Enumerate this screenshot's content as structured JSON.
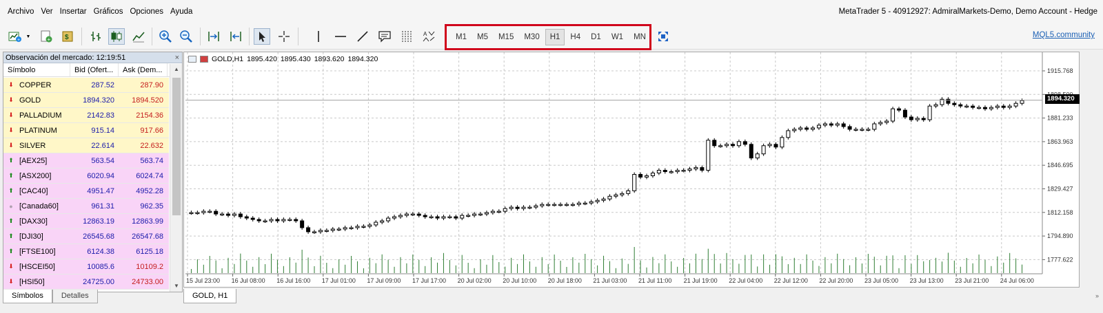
{
  "menu": [
    "Archivo",
    "Ver",
    "Insertar",
    "Gráficos",
    "Opciones",
    "Ayuda"
  ],
  "window_title": "MetaTrader 5 - 40912927: AdmiralMarkets-Demo, Demo Account - Hedge",
  "toolbar": {
    "timeframes": [
      {
        "label": "M1",
        "active": false
      },
      {
        "label": "M5",
        "active": false
      },
      {
        "label": "M15",
        "active": false
      },
      {
        "label": "M30",
        "active": false
      },
      {
        "label": "H1",
        "active": true
      },
      {
        "label": "H4",
        "active": false
      },
      {
        "label": "D1",
        "active": false
      },
      {
        "label": "W1",
        "active": false
      },
      {
        "label": "MN",
        "active": false
      }
    ],
    "timeframe_highlight_color": "#d0021b",
    "mql5_link": "MQL5.community"
  },
  "market_watch": {
    "title": "Observación del mercado: 12:19:51",
    "columns": [
      "Símbolo",
      "Bid (Ofert...",
      "Ask (Dem..."
    ],
    "rows": [
      {
        "symbol": "COPPER",
        "bid": "287.52",
        "ask": "287.90",
        "trend": "down",
        "group": "metal"
      },
      {
        "symbol": "GOLD",
        "bid": "1894.320",
        "ask": "1894.520",
        "trend": "down",
        "group": "metal"
      },
      {
        "symbol": "PALLADIUM",
        "bid": "2142.83",
        "ask": "2154.36",
        "trend": "down",
        "group": "metal"
      },
      {
        "symbol": "PLATINUM",
        "bid": "915.14",
        "ask": "917.66",
        "trend": "down",
        "group": "metal"
      },
      {
        "symbol": "SILVER",
        "bid": "22.614",
        "ask": "22.632",
        "trend": "down",
        "group": "metal"
      },
      {
        "symbol": "[AEX25]",
        "bid": "563.54",
        "ask": "563.74",
        "trend": "up",
        "group": "index"
      },
      {
        "symbol": "[ASX200]",
        "bid": "6020.94",
        "ask": "6024.74",
        "trend": "up",
        "group": "index"
      },
      {
        "symbol": "[CAC40]",
        "bid": "4951.47",
        "ask": "4952.28",
        "trend": "up",
        "group": "index"
      },
      {
        "symbol": "[Canada60]",
        "bid": "961.31",
        "ask": "962.35",
        "trend": "neutral",
        "group": "index"
      },
      {
        "symbol": "[DAX30]",
        "bid": "12863.19",
        "ask": "12863.99",
        "trend": "up",
        "group": "index"
      },
      {
        "symbol": "[DJI30]",
        "bid": "26545.68",
        "ask": "26547.68",
        "trend": "up",
        "group": "index"
      },
      {
        "symbol": "[FTSE100]",
        "bid": "6124.38",
        "ask": "6125.18",
        "trend": "up",
        "group": "index"
      },
      {
        "symbol": "[HSCEI50]",
        "bid": "10085.6",
        "ask": "10109.2",
        "trend": "down",
        "group": "index"
      },
      {
        "symbol": "[HSI50]",
        "bid": "24725.00",
        "ask": "24733.00",
        "trend": "down",
        "group": "index"
      }
    ],
    "tabs": [
      {
        "label": "Símbolos",
        "active": true
      },
      {
        "label": "Detalles",
        "active": false
      }
    ]
  },
  "chart": {
    "header": {
      "symbol": "GOLD,H1",
      "open": "1895.420",
      "high": "1895.430",
      "low": "1893.620",
      "close": "1894.320"
    },
    "current_price": "1894.320",
    "tab_label": "GOLD, H1"
  },
  "chart_data": {
    "type": "candlestick",
    "symbol": "GOLD",
    "timeframe": "H1",
    "y_ticks": [
      "1915.768",
      "1898.500",
      "1881.233",
      "1863.963",
      "1846.695",
      "1829.427",
      "1812.158",
      "1794.890",
      "1777.622"
    ],
    "x_ticks": [
      "15 Jul 23:00",
      "16 Jul 08:00",
      "16 Jul 16:00",
      "17 Jul 01:00",
      "17 Jul 09:00",
      "17 Jul 17:00",
      "20 Jul 02:00",
      "20 Jul 10:00",
      "20 Jul 18:00",
      "21 Jul 03:00",
      "21 Jul 11:00",
      "21 Jul 19:00",
      "22 Jul 04:00",
      "22 Jul 12:00",
      "22 Jul 20:00",
      "23 Jul 05:00",
      "23 Jul 13:00",
      "23 Jul 21:00",
      "24 Jul 06:00"
    ],
    "ylim": [
      1770,
      1920
    ],
    "closes": [
      1812,
      1812,
      1813,
      1813,
      1811,
      1811,
      1810,
      1811,
      1809,
      1808,
      1807,
      1806,
      1806,
      1807,
      1806,
      1807,
      1807,
      1806,
      1801,
      1798,
      1798,
      1799,
      1799,
      1800,
      1800,
      1801,
      1801,
      1802,
      1802,
      1803,
      1805,
      1806,
      1808,
      1809,
      1810,
      1811,
      1811,
      1810,
      1809,
      1809,
      1808,
      1809,
      1809,
      1808,
      1810,
      1810,
      1811,
      1811,
      1812,
      1813,
      1813,
      1815,
      1816,
      1815,
      1816,
      1816,
      1817,
      1818,
      1818,
      1818,
      1818,
      1818,
      1818,
      1819,
      1819,
      1820,
      1821,
      1822,
      1824,
      1825,
      1826,
      1828,
      1840,
      1838,
      1839,
      1841,
      1843,
      1842,
      1842,
      1843,
      1843,
      1844,
      1845,
      1843,
      1865,
      1861,
      1861,
      1862,
      1861,
      1864,
      1862,
      1852,
      1855,
      1861,
      1862,
      1860,
      1867,
      1872,
      1873,
      1874,
      1873,
      1874,
      1876,
      1877,
      1876,
      1877,
      1875,
      1873,
      1873,
      1873,
      1873,
      1877,
      1878,
      1879,
      1888,
      1887,
      1882,
      1880,
      1881,
      1880,
      1890,
      1891,
      1895,
      1892,
      1891,
      1890,
      1890,
      1889,
      1889,
      1888,
      1889,
      1890,
      1889,
      1890,
      1892,
      1894
    ],
    "volume_color": "#2e7d32",
    "grid": true,
    "background": "#ffffff",
    "candle_color": "#000000"
  }
}
